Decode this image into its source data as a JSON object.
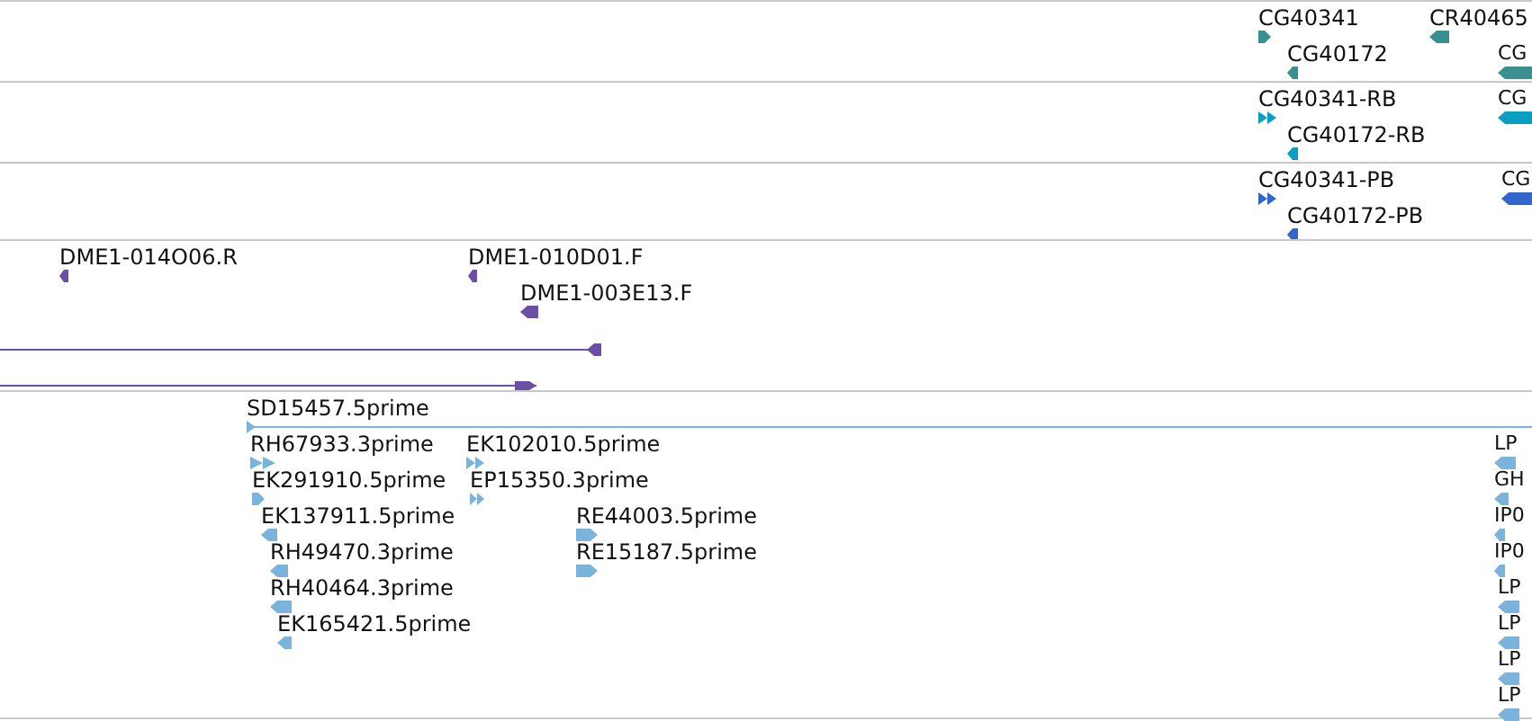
{
  "tracks": [
    {
      "color": "#3a8f8f",
      "features": [
        {
          "label": "CG40341",
          "kind": "single",
          "reverse": false
        },
        {
          "label": "CR40465",
          "kind": "single",
          "reverse": true
        },
        {
          "label": "CG40172",
          "kind": "single",
          "reverse": true
        },
        {
          "label": "CG",
          "kind": "single",
          "reverse": true
        }
      ]
    },
    {
      "color": "#0a9fc2",
      "features": [
        {
          "label": "CG40341-RB",
          "kind": "double",
          "reverse": false
        },
        {
          "label": "CG40172-RB",
          "kind": "single",
          "reverse": true
        },
        {
          "label": "CG",
          "kind": "single",
          "reverse": true
        }
      ]
    },
    {
      "color": "#3366cc",
      "features": [
        {
          "label": "CG40341-PB",
          "kind": "double",
          "reverse": false
        },
        {
          "label": "CG40172-PB",
          "kind": "single",
          "reverse": true
        },
        {
          "label": "CG",
          "kind": "single",
          "reverse": true
        }
      ]
    },
    {
      "color": "#6b4fa6",
      "features": [
        {
          "label": "DME1-014O06.R",
          "kind": "single",
          "reverse": true
        },
        {
          "label": "DME1-010D01.F",
          "kind": "single",
          "reverse": true
        },
        {
          "label": "DME1-003E13.F",
          "kind": "single",
          "reverse": true
        },
        {
          "kind": "long",
          "reverse": true
        },
        {
          "kind": "long",
          "reverse": false
        }
      ]
    },
    {
      "color": "#7ab4dc",
      "features": [
        {
          "label": "SD15457.5prime",
          "kind": "long",
          "reverse": false
        },
        {
          "label": "RH67933.3prime",
          "kind": "double",
          "reverse": false
        },
        {
          "label": "EK102010.5prime",
          "kind": "double",
          "reverse": false
        },
        {
          "label": "EK291910.5prime",
          "kind": "single",
          "reverse": false
        },
        {
          "label": "EP15350.3prime",
          "kind": "double",
          "reverse": false
        },
        {
          "label": "EK137911.5prime",
          "kind": "single",
          "reverse": true
        },
        {
          "label": "RE44003.5prime",
          "kind": "single",
          "reverse": false
        },
        {
          "label": "RH49470.3prime",
          "kind": "single",
          "reverse": true
        },
        {
          "label": "RE15187.5prime",
          "kind": "single",
          "reverse": false
        },
        {
          "label": "RH40464.3prime",
          "kind": "single",
          "reverse": true
        },
        {
          "label": "EK165421.5prime",
          "kind": "single",
          "reverse": true
        },
        {
          "label": "LP",
          "kind": "single",
          "reverse": true
        },
        {
          "label": "GH",
          "kind": "single",
          "reverse": true
        },
        {
          "label": "IP0",
          "kind": "single",
          "reverse": true
        },
        {
          "label": "IP0",
          "kind": "single",
          "reverse": true
        },
        {
          "label": "LP",
          "kind": "single",
          "reverse": true
        },
        {
          "label": "LP",
          "kind": "single",
          "reverse": true
        },
        {
          "label": "LP",
          "kind": "single",
          "reverse": true
        },
        {
          "label": "LP",
          "kind": "single",
          "reverse": true
        }
      ]
    }
  ]
}
